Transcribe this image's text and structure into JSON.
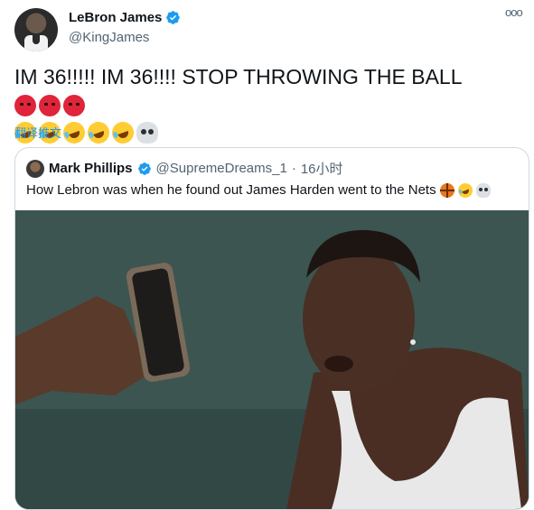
{
  "tweet": {
    "author_name": "LeBron James",
    "author_handle": "@KingJames",
    "text": "IM 36!!!!! IM 36!!!! STOP THROWING THE BALL",
    "trailing_emojis": [
      "pouting-face",
      "pouting-face",
      "pouting-face"
    ],
    "line2_emojis": [
      "rolling-laughing",
      "rolling-laughing",
      "rolling-laughing",
      "rolling-laughing",
      "rolling-laughing",
      "skull"
    ],
    "translate_label": "翻译推文",
    "more_icon": "more-icon"
  },
  "quoted": {
    "author_name": "Mark Phillips",
    "author_handle": "@SupremeDreams_1",
    "separator": "·",
    "time": "16小时",
    "text": "How Lebron was when he found out James Harden went to the Nets",
    "emojis": [
      "basketball",
      "rolling-laughing",
      "skull"
    ]
  },
  "colors": {
    "accent": "#1d9bf0",
    "secondary_text": "#536471",
    "border": "#cfd9de"
  }
}
